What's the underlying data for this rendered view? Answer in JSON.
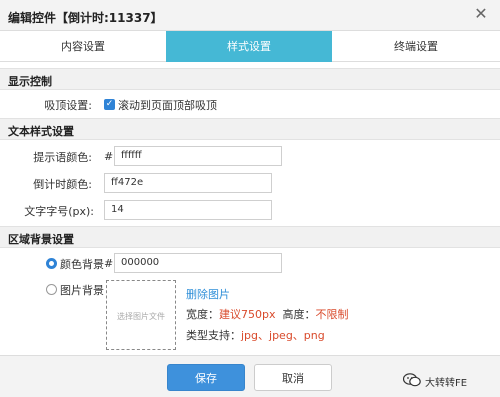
{
  "dialog": {
    "title": "编辑控件【倒计时:11337】",
    "close_label": "✕"
  },
  "tabs": [
    {
      "label": "内容设置",
      "active": false
    },
    {
      "label": "样式设置",
      "active": true
    },
    {
      "label": "终端设置",
      "active": false
    }
  ],
  "display": {
    "section_title": "显示控制",
    "sticky_label": "吸顶设置:",
    "sticky_checkbox_label": "滚动到页面顶部吸顶",
    "sticky_checked": true
  },
  "text_style": {
    "section_title": "文本样式设置",
    "hint_color_label": "提示语颜色:",
    "hint_color_value": "ffffff",
    "countdown_color_label": "倒计时颜色:",
    "countdown_color_value": "ff472e",
    "font_size_label": "文字字号(px):",
    "font_size_value": "14"
  },
  "background": {
    "section_title": "区域背景设置",
    "color_bg_label": "颜色背景",
    "color_bg_value": "000000",
    "color_bg_selected": true,
    "image_bg_label": "图片背景",
    "image_bg_selected": false,
    "dropzone_text": "选择图片文件",
    "delete_image": "删除图片",
    "width_label": "宽度：",
    "width_value": "建议750px",
    "height_label": "高度：",
    "height_value": "不限制",
    "types_label": "类型支持：",
    "types_value": "jpg、jpeg、png"
  },
  "footer": {
    "save_label": "保存",
    "cancel_label": "取消"
  },
  "watermark": {
    "text": "大转转FE"
  },
  "colors": {
    "tab_active": "#45b8d5",
    "primary": "#3e91dc",
    "link": "#2f8fd8",
    "emphasis": "#d94a2b"
  }
}
